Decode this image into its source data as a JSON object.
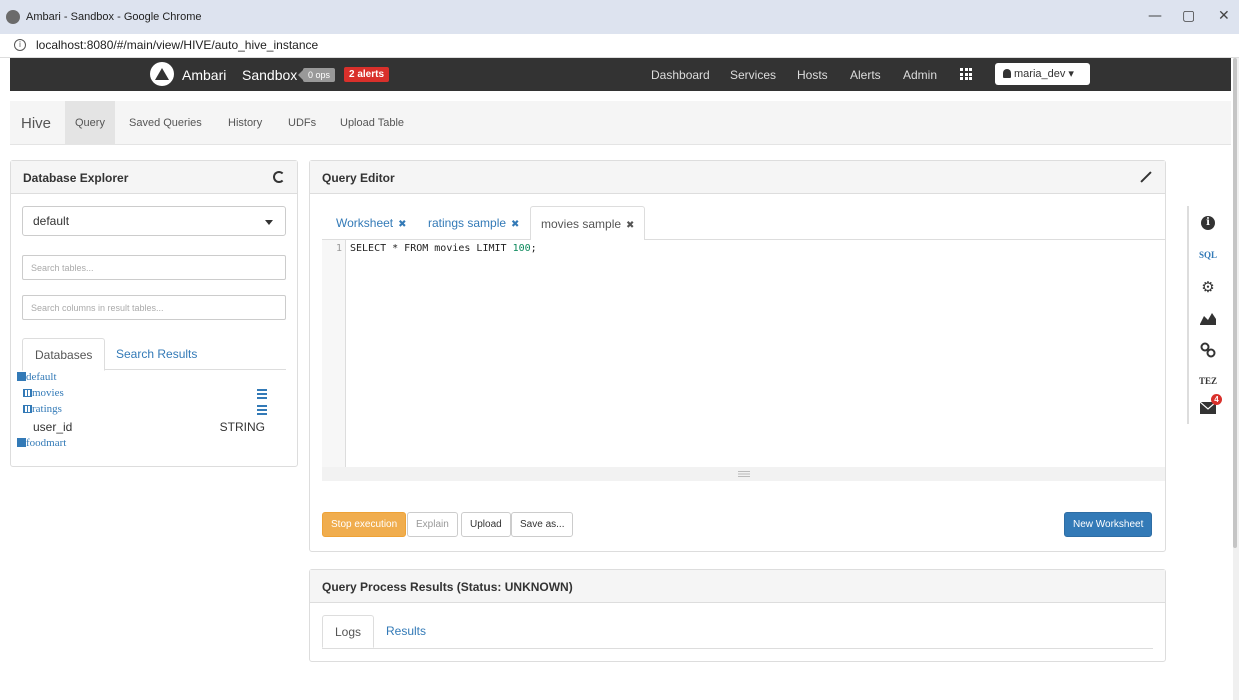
{
  "browser": {
    "window_title": "Ambari - Sandbox - Google Chrome",
    "url": "localhost:8080/#/main/view/HIVE/auto_hive_instance",
    "minimize": "—",
    "restore": "▢",
    "close": "✕"
  },
  "ambari": {
    "brand": "Ambari",
    "cluster": "Sandbox",
    "ops_badge": "0 ops",
    "alerts_badge": "2 alerts",
    "nav": [
      "Dashboard",
      "Services",
      "Hosts",
      "Alerts",
      "Admin"
    ],
    "user": "maria_dev ▾"
  },
  "hive_nav": {
    "title": "Hive",
    "items": [
      "Query",
      "Saved Queries",
      "History",
      "UDFs",
      "Upload Table"
    ],
    "active": "Query"
  },
  "db_explorer": {
    "title": "Database Explorer",
    "selected_db": "default",
    "search_tables_placeholder": "Search tables...",
    "search_columns_placeholder": "Search columns in result tables...",
    "tabs": [
      "Databases",
      "Search Results"
    ],
    "tree": {
      "db1": "default",
      "table1": "movies",
      "table2": "ratings",
      "column_name": "user_id",
      "column_type": "STRING",
      "db2": "foodmart"
    }
  },
  "query_editor": {
    "title": "Query Editor",
    "tabs": [
      "Worksheet",
      "ratings sample",
      "movies sample"
    ],
    "tab_close": "✖",
    "line_number": "1",
    "code_prefix": "SELECT * FROM movies LIMIT ",
    "code_number": "100",
    "code_suffix": ";",
    "buttons": {
      "stop": "Stop execution",
      "explain": "Explain",
      "upload": "Upload",
      "save_as": "Save as...",
      "new_worksheet": "New Worksheet"
    }
  },
  "results": {
    "title": "Query Process Results (Status: UNKNOWN)",
    "tabs": [
      "Logs",
      "Results"
    ]
  },
  "right_toolbar": {
    "sql": "SQL",
    "tez": "TEZ",
    "notification_count": "4"
  }
}
